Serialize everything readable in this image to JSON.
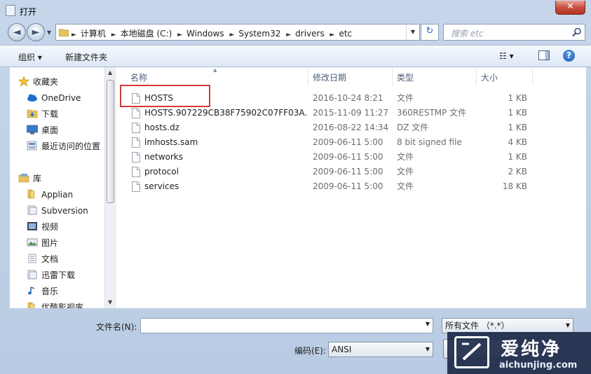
{
  "window": {
    "title": "打开",
    "close_glyph": "✕"
  },
  "nav": {
    "back_glyph": "◄",
    "forward_glyph": "►",
    "breadcrumb": [
      "计算机",
      "本地磁盘 (C:)",
      "Windows",
      "System32",
      "drivers",
      "etc"
    ],
    "search_placeholder": "搜索 etc"
  },
  "toolbar": {
    "organize": "组织 ▾",
    "new_folder": "新建文件夹",
    "view_glyph": "☷ ▾",
    "help": "?"
  },
  "sidebar": {
    "favorites": [
      {
        "label": "收藏夹",
        "icon": "star-icon"
      },
      {
        "label": "OneDrive",
        "icon": "cloud-icon"
      },
      {
        "label": "下载",
        "icon": "download-folder-icon"
      },
      {
        "label": "桌面",
        "icon": "desktop-icon"
      },
      {
        "label": "最近访问的位置",
        "icon": "recent-places-icon"
      }
    ],
    "libraries": [
      {
        "label": "库",
        "icon": "library-icon"
      },
      {
        "label": "Applian",
        "icon": "folder-icon"
      },
      {
        "label": "Subversion",
        "icon": "document-library-icon"
      },
      {
        "label": "视频",
        "icon": "video-icon"
      },
      {
        "label": "图片",
        "icon": "picture-icon"
      },
      {
        "label": "文档",
        "icon": "document-icon"
      },
      {
        "label": "迅雷下载",
        "icon": "document-library-icon"
      },
      {
        "label": "音乐",
        "icon": "music-icon"
      },
      {
        "label": "优酷影视库",
        "icon": "folder-icon"
      }
    ]
  },
  "columns": {
    "name": "名称",
    "date": "修改日期",
    "type": "类型",
    "size": "大小"
  },
  "files": [
    {
      "name": "HOSTS",
      "date": "2016-10-24 8:21",
      "type": "文件",
      "size": "1 KB"
    },
    {
      "name": "HOSTS.907229CB38F75902C07FF03A...",
      "date": "2015-11-09 11:27",
      "type": "360RESTMP 文件",
      "size": "1 KB"
    },
    {
      "name": "hosts.dz",
      "date": "2016-08-22 14:34",
      "type": "DZ 文件",
      "size": "1 KB"
    },
    {
      "name": "lmhosts.sam",
      "date": "2009-06-11 5:00",
      "type": "8 bit signed file",
      "size": "4 KB"
    },
    {
      "name": "networks",
      "date": "2009-06-11 5:00",
      "type": "文件",
      "size": "1 KB"
    },
    {
      "name": "protocol",
      "date": "2009-06-11 5:00",
      "type": "文件",
      "size": "2 KB"
    },
    {
      "name": "services",
      "date": "2009-06-11 5:00",
      "type": "文件",
      "size": "18 KB"
    }
  ],
  "footer": {
    "filename_label": "文件名(N):",
    "filename_value": "",
    "filetype_value": "所有文件 （*.*）",
    "encoding_label": "编码(E):",
    "encoding_value": "ANSI"
  },
  "watermark": {
    "cn": "爱纯净",
    "en": "aichunjing.com"
  },
  "colors": {
    "highlight": "#d23a3a",
    "accent": "#2d6ec4"
  }
}
